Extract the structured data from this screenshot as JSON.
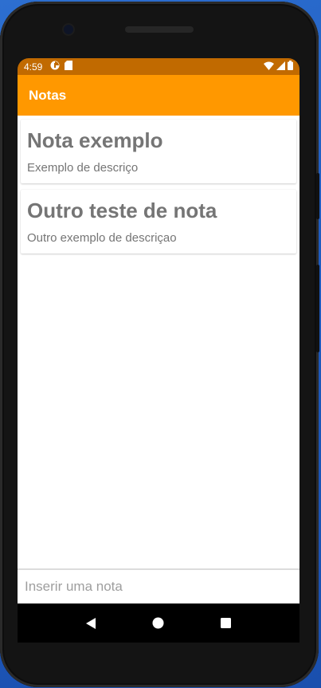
{
  "status_bar": {
    "time": "4:59",
    "icons": [
      "data-saver-icon",
      "sd-card-icon",
      "wifi-icon",
      "signal-icon",
      "battery-icon"
    ]
  },
  "app_bar": {
    "title": "Notas",
    "color": "#ff9800"
  },
  "notes": [
    {
      "title": "Nota exemplo",
      "description": "Exemplo de descriço"
    },
    {
      "title": "Outro teste de nota",
      "description": "Outro exemplo de descriçao"
    }
  ],
  "input": {
    "placeholder": "Inserir uma nota",
    "value": ""
  },
  "nav_bar": {
    "buttons": [
      "back",
      "home",
      "recents"
    ]
  }
}
